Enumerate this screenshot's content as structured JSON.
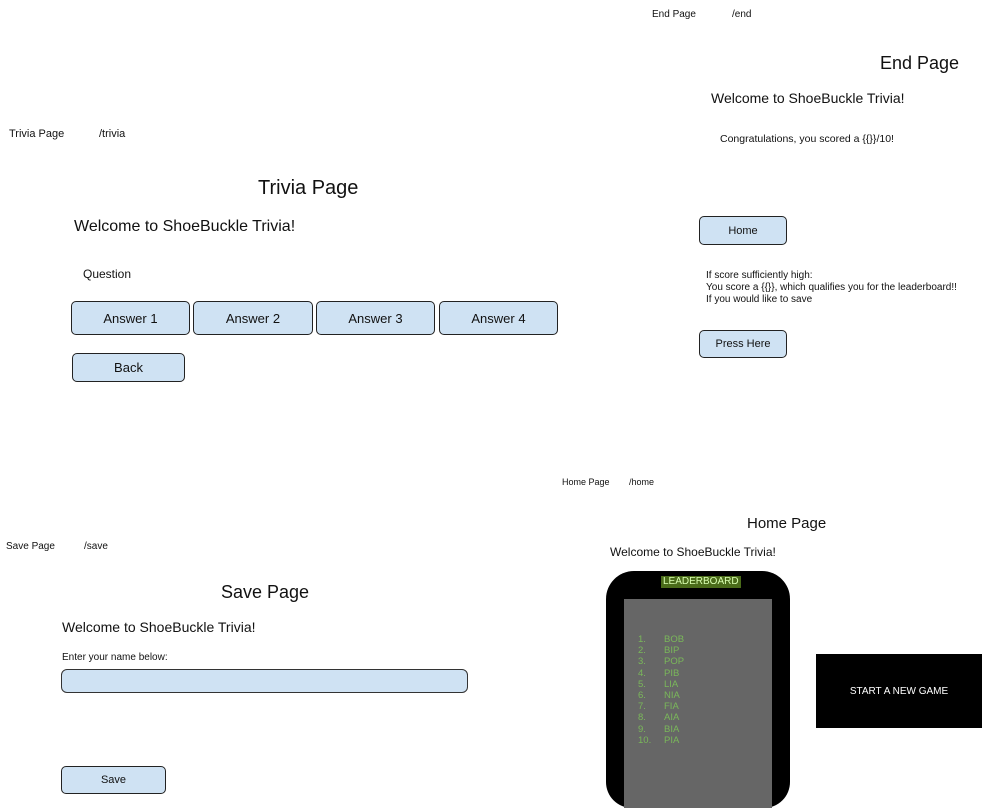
{
  "trivia": {
    "label": "Trivia Page",
    "route": "/trivia",
    "heading": "Trivia Page",
    "welcome": "Welcome to ShoeBuckle Trivia!",
    "question": "Question",
    "answers": [
      "Answer 1",
      "Answer 2",
      "Answer 3",
      "Answer 4"
    ],
    "back_label": "Back"
  },
  "end": {
    "label": "End Page",
    "route": "/end",
    "heading": "End Page",
    "welcome": "Welcome to ShoeBuckle Trivia!",
    "congrats": "Congratulations, you scored a {{}}/10!",
    "home_label": "Home",
    "note_lines": [
      "If score sufficiently high:",
      "You score a {{}}, which qualifies you for the leaderboard!!",
      "If you would like to save"
    ],
    "press_label": "Press Here"
  },
  "save": {
    "label": "Save Page",
    "route": "/save",
    "heading": "Save Page",
    "welcome": "Welcome to ShoeBuckle Trivia!",
    "prompt": "Enter your name below:",
    "name_value": "",
    "save_label": "Save"
  },
  "home": {
    "label": "Home Page",
    "route": "/home",
    "heading": "Home Page",
    "welcome": "Welcome to ShoeBuckle Trivia!",
    "leaderboard_title": "LEADERBOARD",
    "leaderboard": [
      {
        "rank": "1.",
        "name": "BOB"
      },
      {
        "rank": "2.",
        "name": "BIP"
      },
      {
        "rank": "3.",
        "name": "POP"
      },
      {
        "rank": "4.",
        "name": "PIB"
      },
      {
        "rank": "5.",
        "name": "LIA"
      },
      {
        "rank": "6.",
        "name": "NIA"
      },
      {
        "rank": "7.",
        "name": "FIA"
      },
      {
        "rank": "8.",
        "name": "AIA"
      },
      {
        "rank": "9.",
        "name": "BIA"
      },
      {
        "rank": "10.",
        "name": "PIA"
      }
    ],
    "new_game_label": "START A NEW GAME"
  },
  "colors": {
    "button_fill": "#cfe2f3",
    "leaderboard_screen": "#666666",
    "leaderboard_text": "#7ab85a",
    "leaderboard_title_bg": "#4a6b1a",
    "device_frame": "#000000"
  }
}
